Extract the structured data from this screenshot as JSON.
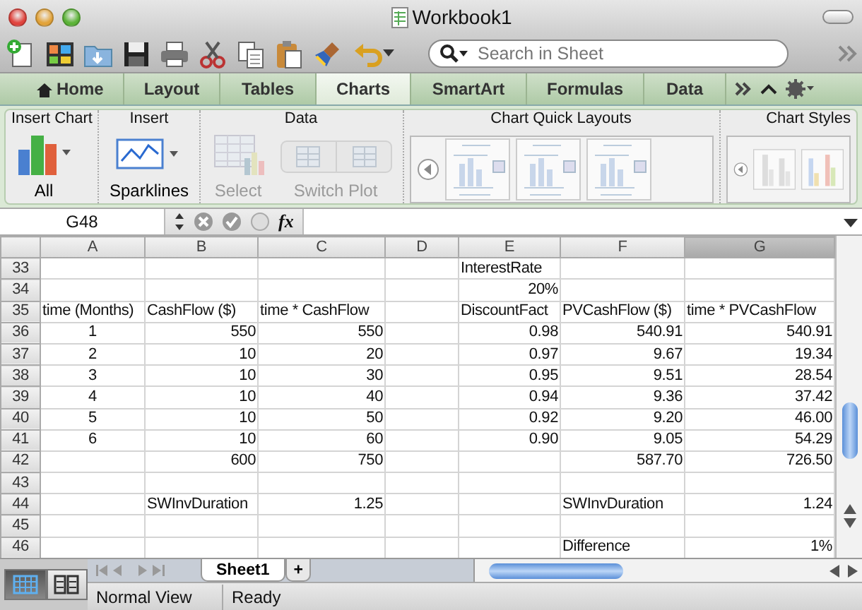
{
  "window": {
    "title": "Workbook1"
  },
  "toolbar": {
    "search_placeholder": "Search in Sheet"
  },
  "ribbon_tabs": [
    {
      "label": "Home",
      "selected": false
    },
    {
      "label": "Layout",
      "selected": false
    },
    {
      "label": "Tables",
      "selected": false
    },
    {
      "label": "Charts",
      "selected": true
    },
    {
      "label": "SmartArt",
      "selected": false
    },
    {
      "label": "Formulas",
      "selected": false
    },
    {
      "label": "Data",
      "selected": false
    }
  ],
  "ribbon_groups": [
    {
      "title": "Insert Chart",
      "kind": "buttons",
      "buttons": [
        {
          "label": "All",
          "kind": "chart",
          "disabled": false
        }
      ]
    },
    {
      "title": "Insert",
      "kind": "buttons",
      "buttons": [
        {
          "label": "Sparklines",
          "kind": "sparkline",
          "disabled": false
        }
      ]
    },
    {
      "title": "Data",
      "kind": "buttons",
      "buttons": [
        {
          "label": "Select",
          "kind": "select",
          "disabled": true
        },
        {
          "label": "Switch Plot",
          "kind": "switch",
          "disabled": true
        }
      ]
    },
    {
      "title": "Chart Quick Layouts",
      "kind": "layouts"
    },
    {
      "title": "Chart Styles",
      "kind": "styles"
    }
  ],
  "formula_bar": {
    "name_box": "G48",
    "fx": "fx"
  },
  "columns": [
    {
      "label": "A",
      "selected": false
    },
    {
      "label": "B",
      "selected": false
    },
    {
      "label": "C",
      "selected": false
    },
    {
      "label": "D",
      "selected": false
    },
    {
      "label": "E",
      "selected": false
    },
    {
      "label": "F",
      "selected": false
    },
    {
      "label": "G",
      "selected": true
    }
  ],
  "rows": [
    {
      "number": "33",
      "cells": [
        "",
        "",
        "",
        "",
        "InterestRate",
        "",
        ""
      ]
    },
    {
      "number": "34",
      "cells": [
        "",
        "",
        "",
        "",
        "20%",
        "",
        ""
      ]
    },
    {
      "number": "35",
      "cells": [
        "time (Months)",
        "CashFlow ($)",
        "time * CashFlow",
        "",
        "DiscountFact",
        "PVCashFlow ($)",
        "time * PVCashFlow"
      ]
    },
    {
      "number": "36",
      "cells": [
        "1",
        "550",
        "550",
        "",
        "0.98",
        "540.91",
        "540.91"
      ]
    },
    {
      "number": "37",
      "cells": [
        "2",
        "10",
        "20",
        "",
        "0.97",
        "9.67",
        "19.34"
      ]
    },
    {
      "number": "38",
      "cells": [
        "3",
        "10",
        "30",
        "",
        "0.95",
        "9.51",
        "28.54"
      ]
    },
    {
      "number": "39",
      "cells": [
        "4",
        "10",
        "40",
        "",
        "0.94",
        "9.36",
        "37.42"
      ]
    },
    {
      "number": "40",
      "cells": [
        "5",
        "10",
        "50",
        "",
        "0.92",
        "9.20",
        "46.00"
      ]
    },
    {
      "number": "41",
      "cells": [
        "6",
        "10",
        "60",
        "",
        "0.90",
        "9.05",
        "54.29"
      ]
    },
    {
      "number": "42",
      "cells": [
        "",
        "600",
        "750",
        "",
        "",
        "587.70",
        "726.50"
      ]
    },
    {
      "number": "43",
      "cells": [
        "",
        "",
        "",
        "",
        "",
        "",
        ""
      ]
    },
    {
      "number": "44",
      "cells": [
        "",
        "SWInvDuration",
        "1.25",
        "",
        "",
        "SWInvDuration",
        "1.24"
      ]
    },
    {
      "number": "45",
      "cells": [
        "",
        "",
        "",
        "",
        "",
        "",
        ""
      ]
    },
    {
      "number": "46",
      "cells": [
        "",
        "",
        "",
        "",
        "",
        "Difference",
        "1%"
      ]
    }
  ],
  "sheet_tabs": [
    {
      "label": "Sheet1",
      "selected": true
    }
  ],
  "add_sheet": "+",
  "view_buttons": [
    {
      "kind": "normal",
      "selected": true
    },
    {
      "kind": "page-layout",
      "selected": false
    }
  ],
  "status_bar": {
    "view": "Normal View",
    "state": "Ready"
  }
}
